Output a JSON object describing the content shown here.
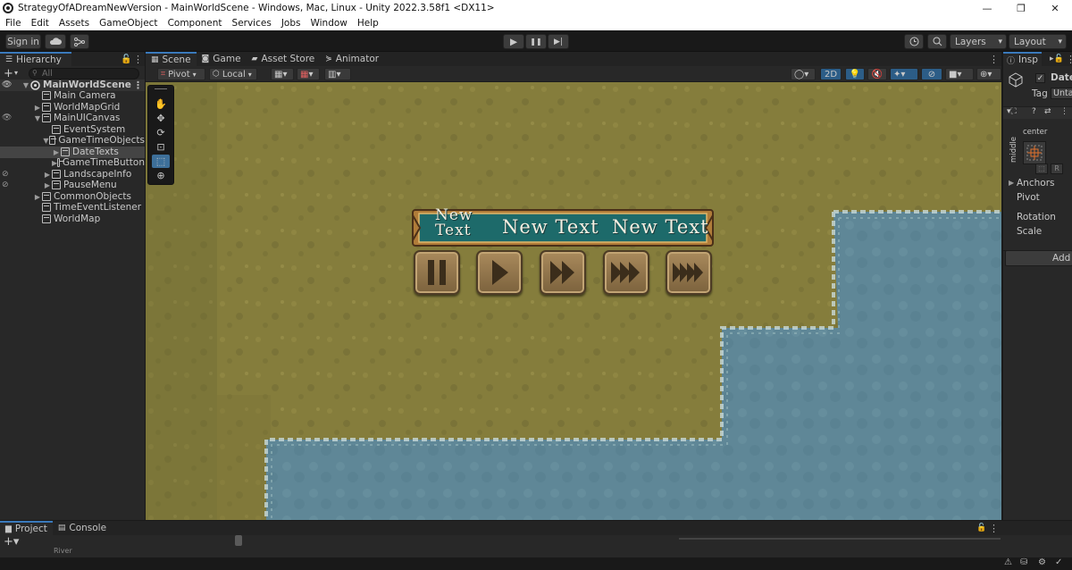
{
  "window": {
    "title": "StrategyOfADreamNewVersion - MainWorldScene - Windows, Mac, Linux - Unity 2022.3.58f1 <DX11>",
    "minimize": "—",
    "maximize": "❐",
    "close": "✕"
  },
  "menu": [
    "File",
    "Edit",
    "Assets",
    "GameObject",
    "Component",
    "Services",
    "Jobs",
    "Window",
    "Help"
  ],
  "toolbar": {
    "sign_in": "Sign in",
    "play": "▶",
    "pause": "❚❚",
    "step": "▶|",
    "layers": "Layers",
    "layout": "Layout"
  },
  "hierarchy": {
    "tab": "Hierarchy",
    "search_placeholder": "All",
    "items": [
      {
        "label": "MainWorldScene"
      },
      {
        "label": "Main Camera"
      },
      {
        "label": "WorldMapGrid"
      },
      {
        "label": "MainUICanvas"
      },
      {
        "label": "EventSystem"
      },
      {
        "label": "GameTimeObjects"
      },
      {
        "label": "DateTexts"
      },
      {
        "label": "GameTimeButton"
      },
      {
        "label": "LandscapeInfo"
      },
      {
        "label": "PauseMenu"
      },
      {
        "label": "CommonObjects"
      },
      {
        "label": "TimeEventListener"
      },
      {
        "label": "WorldMap"
      }
    ]
  },
  "scene_tabs": [
    {
      "label": "Scene"
    },
    {
      "label": "Game"
    },
    {
      "label": "Asset Store"
    },
    {
      "label": "Animator"
    }
  ],
  "scene_toolbar": {
    "pivot": "Pivot",
    "local": "Local",
    "mode_2d": "2D"
  },
  "game_ui": {
    "date_texts": [
      "New Text",
      "New Text",
      "New Text"
    ],
    "colors": {
      "banner": "#1f6b6b",
      "frame": "#b5833d",
      "button": "#8a6c43",
      "grass": "#8a8140",
      "water": "#5e8796"
    }
  },
  "inspector": {
    "tab": "Insp",
    "object_name": "Date",
    "tag_label": "Tag",
    "tag_value": "Unta",
    "anchor_h": "center",
    "anchor_v": "middle",
    "anchors": "Anchors",
    "pivot": "Pivot",
    "rotation": "Rotation",
    "scale": "Scale",
    "add_component": "Add C"
  },
  "bottom": {
    "project_tab": "Project",
    "console_tab": "Console",
    "partial_item": "River"
  }
}
